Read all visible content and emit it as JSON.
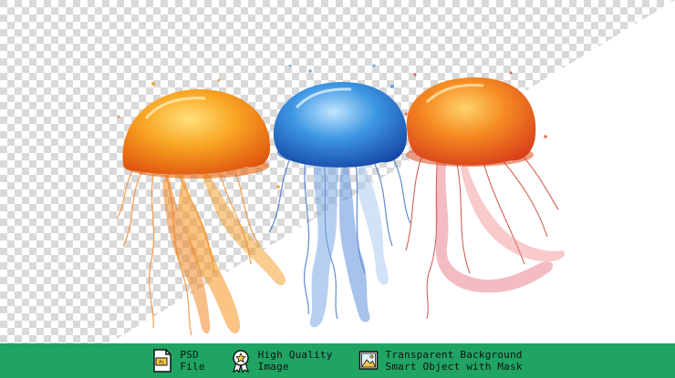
{
  "colors": {
    "footer_bg": "#1fa463",
    "checker_light": "#ffffff",
    "checker_dark": "#d9d9d9",
    "jelly_orange": "#f79a1e",
    "jelly_blue": "#2f86d6",
    "jelly_red_orange": "#f2741c"
  },
  "image": {
    "subjects": [
      "orange-jellyfish",
      "blue-jellyfish",
      "orange-red-jellyfish"
    ],
    "background": "transparent-checkerboard-with-white-diagonal"
  },
  "footer": {
    "features": [
      {
        "icon": "psd-file-icon",
        "line1": "PSD",
        "line2": "File"
      },
      {
        "icon": "quality-badge-icon",
        "line1": "High Quality",
        "line2": "Image"
      },
      {
        "icon": "image-mask-icon",
        "line1": "Transparent Background",
        "line2": "Smart Object with Mask"
      }
    ]
  }
}
